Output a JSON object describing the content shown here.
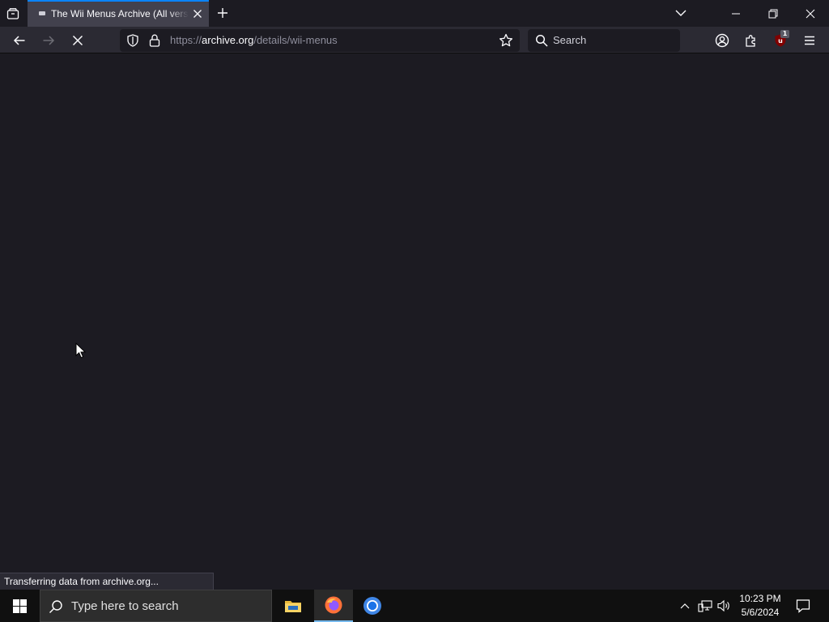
{
  "browser": {
    "tab": {
      "title": "The Wii Menus Archive (All versions)"
    },
    "urlbar": {
      "scheme": "https://",
      "host": "archive.org",
      "path": "/details/wii-menus"
    },
    "searchbar": {
      "placeholder": "Search"
    },
    "extension_badge": "1",
    "status_text": "Transferring data from archive.org..."
  },
  "taskbar": {
    "search_placeholder": "Type here to search",
    "clock": {
      "time": "10:23 PM",
      "date": "5/6/2024"
    }
  },
  "icons": {
    "tab_list": "tab-list-icon",
    "favicon": "favicon-icon",
    "tab_close": "close-icon",
    "new_tab": "plus-icon",
    "tabs_overflow": "chevron-down-icon",
    "minimize": "minimize-icon",
    "restore": "restore-icon",
    "window_close": "close-icon",
    "back": "arrow-left-icon",
    "forward": "arrow-right-icon",
    "stop": "stop-icon",
    "shield": "shield-icon",
    "lock": "lock-icon",
    "bookmark": "star-icon",
    "search": "search-icon",
    "account": "account-icon",
    "extensions": "puzzle-icon",
    "ublock": "ublock-icon",
    "menu": "hamburger-icon",
    "windows": "windows-logo-icon",
    "file_explorer": "folder-icon",
    "firefox": "firefox-icon",
    "chrome": "chrome-icon",
    "tray_overflow": "chevron-up-icon",
    "network": "network-icon",
    "volume": "volume-icon",
    "notifications": "notification-icon"
  },
  "colors": {
    "accent": "#0a84ff",
    "page_background": "#1c1b22",
    "toolbar_background": "#2b2a33",
    "taskbar_background": "#101010"
  }
}
